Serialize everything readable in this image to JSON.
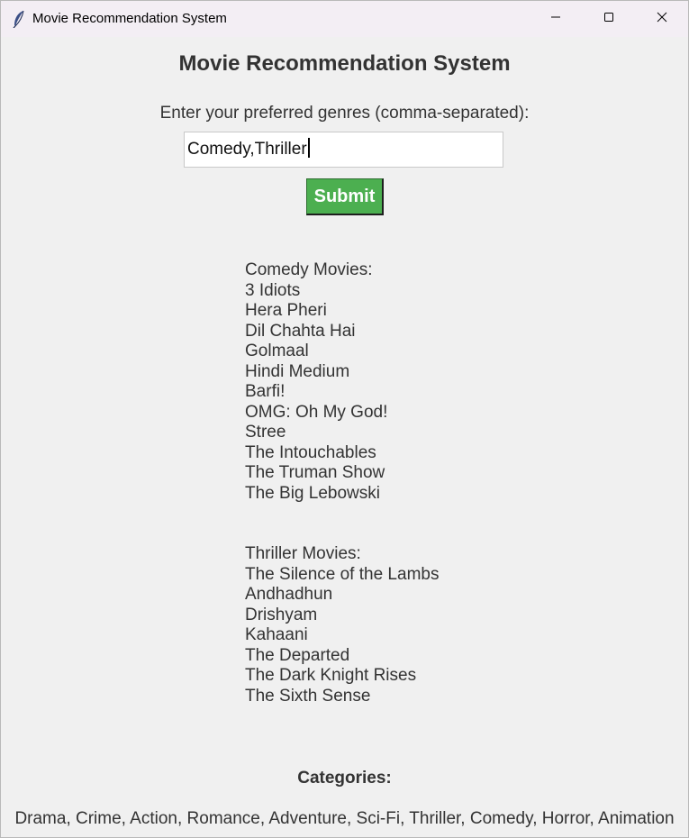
{
  "window": {
    "title": "Movie Recommendation System"
  },
  "app": {
    "title": "Movie Recommendation System",
    "prompt": "Enter your preferred genres (comma-separated):",
    "input_value": "Comedy,Thriller",
    "submit_label": "Submit"
  },
  "results": {
    "comedy_header": "Comedy Movies:",
    "comedy": [
      "3 Idiots",
      "Hera Pheri",
      "Dil Chahta Hai",
      "Golmaal",
      "Hindi Medium",
      "Barfi!",
      "OMG: Oh My God!",
      "Stree",
      "The Intouchables",
      "The Truman Show",
      "The Big Lebowski"
    ],
    "thriller_header": "Thriller Movies:",
    "thriller": [
      "The Silence of the Lambs",
      "Andhadhun",
      "Drishyam",
      "Kahaani",
      "The Departed",
      "The Dark Knight Rises",
      "The Sixth Sense"
    ]
  },
  "categories": {
    "label": "Categories:",
    "list": "Drama, Crime, Action, Romance, Adventure, Sci-Fi, Thriller, Comedy, Horror, Animation"
  },
  "icons": {
    "app": "feather-icon",
    "minimize": "minimize-icon",
    "maximize": "maximize-icon",
    "close": "close-icon"
  },
  "colors": {
    "submit_bg": "#4caf50",
    "text": "#333333",
    "background": "#f0f0f0"
  }
}
